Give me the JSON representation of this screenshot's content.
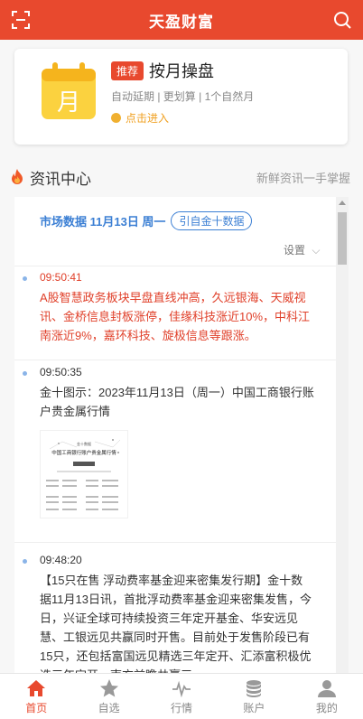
{
  "app": {
    "title": "天盈财富"
  },
  "promo": {
    "calendar_char": "月",
    "badge": "推荐",
    "name": "按月操盘",
    "meta": "自动延期 | 更划算 | 1个自然月",
    "enter": "点击进入"
  },
  "news_section": {
    "title": "资讯中心",
    "subtitle": "新鲜资讯一手掌握"
  },
  "feed": {
    "market_title": "市场数据 11月13日 周一",
    "source_badge": "引自金十数据",
    "settings_label": "设置",
    "items": [
      {
        "time": "09:50:41",
        "text": "A股智慧政务板块早盘直线冲高，久远银海、天威视讯、金桥信息封板涨停，佳缘科技涨近10%，中科江南涨近9%，嘉环科技、旋极信息等跟涨。",
        "color": "#e0402a"
      },
      {
        "time": "09:50:35",
        "text": "金十图示：2023年11月13日（周一）中国工商银行账户贵金属行情",
        "color": "#333333"
      },
      {
        "time": "09:48:20",
        "text": "【15只在售 浮动费率基金迎来密集发行期】金十数据11月13日讯，首批浮动费率基金迎来密集发售，今日，兴证全球可持续投资三年定开基金、华安远见慧、工银远见共赢同时开售。目前处于发售阶段已有15只，还包括富国远见精选三年定开、汇添富积极优选三年定开、南方前瞻共赢三",
        "color": "#333333"
      }
    ],
    "thumbnail_caption": "中国工商银行账户贵金属行情"
  },
  "tabs": [
    {
      "label": "首页",
      "icon": "home-icon",
      "active": true
    },
    {
      "label": "自选",
      "icon": "star-icon",
      "active": false
    },
    {
      "label": "行情",
      "icon": "pulse-icon",
      "active": false
    },
    {
      "label": "账户",
      "icon": "coins-icon",
      "active": false
    },
    {
      "label": "我的",
      "icon": "user-icon",
      "active": false
    }
  ],
  "colors": {
    "brand": "#e8492e",
    "accent_blue": "#3b7fd4",
    "gold": "#f0a020"
  }
}
